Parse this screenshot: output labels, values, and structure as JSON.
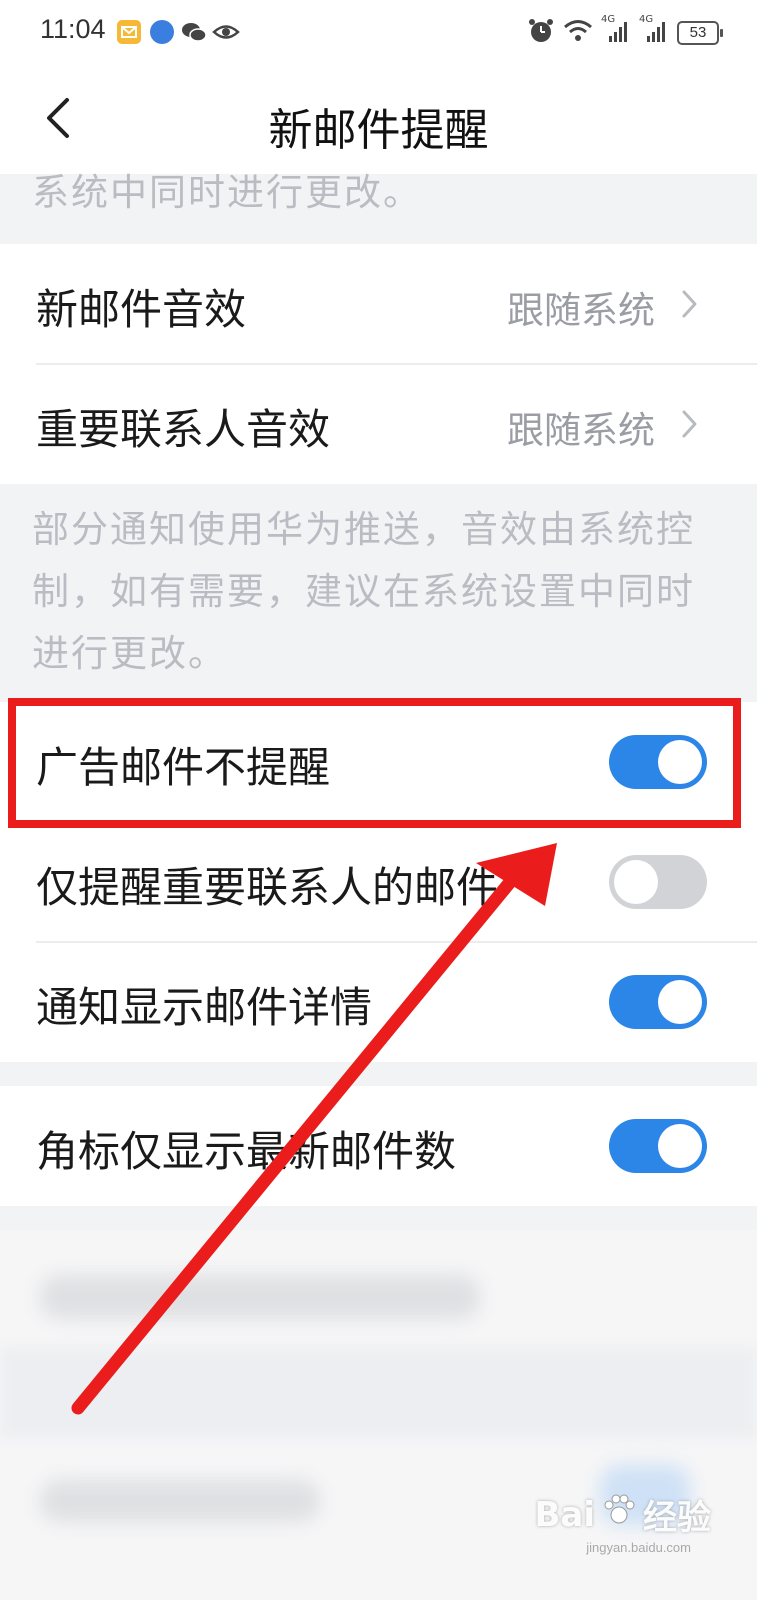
{
  "status_bar": {
    "time": "11:04",
    "battery": "53",
    "app_icons": [
      "mail-app-icon",
      "browser-app-icon",
      "wechat-app-icon",
      "eye-app-icon"
    ],
    "right_icons": [
      "alarm-icon",
      "wifi-icon",
      "signal-4g-icon",
      "signal-4g-icon"
    ],
    "signal_label": "4G"
  },
  "header": {
    "title": "新邮件提醒",
    "back_icon": "chevron-left-icon"
  },
  "top_note": "系统中同时进行更改。",
  "sound_settings": [
    {
      "label": "新邮件音效",
      "value": "跟随系统"
    },
    {
      "label": "重要联系人音效",
      "value": "跟随系统"
    }
  ],
  "push_note": "部分通知使用华为推送，音效由系统控制，如有需要，建议在系统设置中同时进行更改。",
  "notification_toggles": [
    {
      "label": "广告邮件不提醒",
      "state": "on"
    },
    {
      "label": "仅提醒重要联系人的邮件",
      "state": "off"
    },
    {
      "label": "通知显示邮件详情",
      "state": "on"
    }
  ],
  "badge_toggle": {
    "label": "角标仅显示最新邮件数",
    "state": "on"
  },
  "colors": {
    "toggle_on": "#2b86e8",
    "toggle_off": "#d2d3d6",
    "annotation_red": "#ea1c1c"
  },
  "watermark": {
    "brand": "Bai",
    "brand_suffix": "经验",
    "url": "jingyan.baidu.com"
  }
}
